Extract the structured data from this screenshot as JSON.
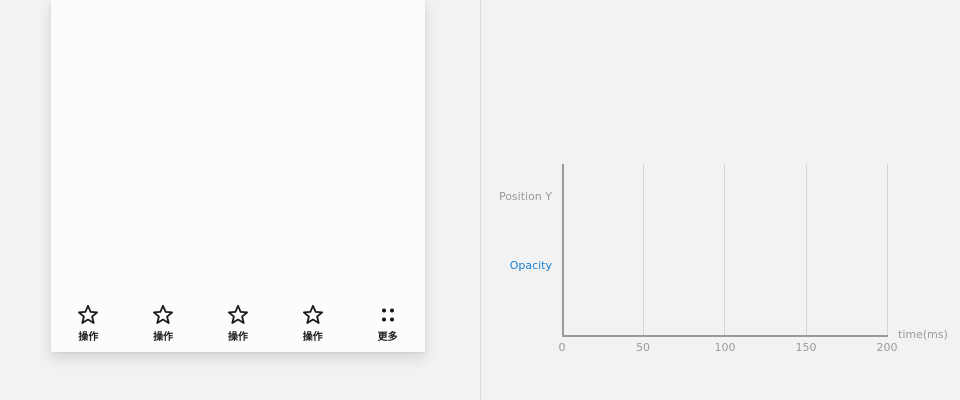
{
  "toolbar": {
    "items": [
      {
        "label": "操作",
        "icon": "star-outline-icon"
      },
      {
        "label": "操作",
        "icon": "star-outline-icon"
      },
      {
        "label": "操作",
        "icon": "star-outline-icon"
      },
      {
        "label": "操作",
        "icon": "star-outline-icon"
      },
      {
        "label": "更多",
        "icon": "more-dots-icon"
      }
    ]
  },
  "graph": {
    "rows": {
      "position_y": {
        "label": "Position Y",
        "color": "#9a9a9a"
      },
      "opacity": {
        "label": "Opacity",
        "color": "#1a7fcf"
      }
    },
    "ticks": [
      "0",
      "50",
      "100",
      "150",
      "200"
    ],
    "unit_label": "time(ms)",
    "colors": {
      "axis": "#9a9a9a",
      "grid": "#d4d4d4"
    }
  }
}
